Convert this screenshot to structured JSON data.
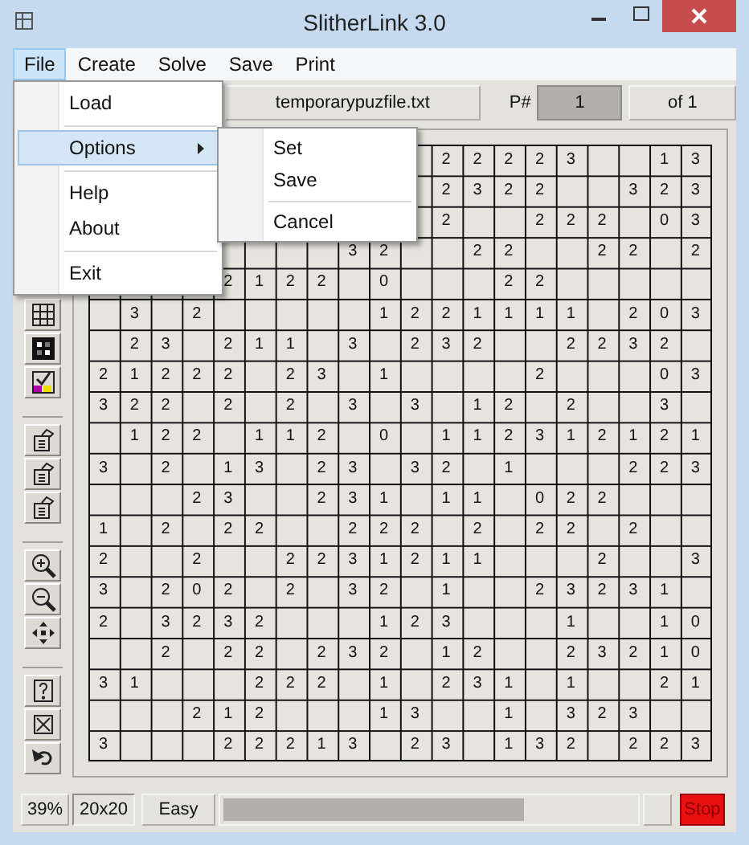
{
  "window": {
    "title": "SlitherLink 3.0"
  },
  "menu_bar": [
    {
      "label": "File",
      "selected": true
    },
    {
      "label": "Create",
      "selected": false
    },
    {
      "label": "Solve",
      "selected": false
    },
    {
      "label": "Save",
      "selected": false
    },
    {
      "label": "Print",
      "selected": false
    }
  ],
  "file_menu": [
    {
      "label": "Load",
      "selected": false,
      "separator_before": false,
      "has_submenu": false
    },
    {
      "label": "Options",
      "selected": true,
      "separator_before": true,
      "has_submenu": true
    },
    {
      "label": "Help",
      "selected": false,
      "separator_before": true,
      "has_submenu": false
    },
    {
      "label": "About",
      "selected": false,
      "separator_before": false,
      "has_submenu": false
    },
    {
      "label": "Exit",
      "selected": false,
      "separator_before": true,
      "has_submenu": false
    }
  ],
  "options_submenu": [
    {
      "label": "Set",
      "selected": false,
      "separator_before": false
    },
    {
      "label": "Save",
      "selected": false,
      "separator_before": false
    },
    {
      "label": "Cancel",
      "selected": false,
      "separator_before": true
    }
  ],
  "toolbar": {
    "file_name": "temporarypuzfile.txt",
    "puzzle_label": "P#",
    "puzzle_number": "1",
    "puzzle_count": "of 1"
  },
  "grid": {
    "rows": [
      [
        null,
        null,
        null,
        null,
        null,
        null,
        null,
        null,
        null,
        null,
        null,
        "2",
        "2",
        "2",
        "2",
        "3",
        null,
        null,
        "1",
        "3"
      ],
      [
        null,
        null,
        null,
        null,
        null,
        null,
        null,
        null,
        null,
        null,
        null,
        "2",
        "3",
        "2",
        "2",
        null,
        null,
        "3",
        "2",
        "3"
      ],
      [
        null,
        null,
        null,
        null,
        null,
        null,
        null,
        null,
        null,
        null,
        null,
        "2",
        null,
        null,
        "2",
        "2",
        "2",
        null,
        "0",
        "3"
      ],
      [
        null,
        null,
        null,
        null,
        null,
        null,
        null,
        null,
        "3",
        "2",
        null,
        null,
        "2",
        "2",
        null,
        null,
        "2",
        "2",
        null,
        "2"
      ],
      [
        null,
        null,
        null,
        null,
        "2",
        "1",
        "2",
        "2",
        null,
        "0",
        null,
        null,
        null,
        "2",
        "2",
        null,
        null,
        null,
        null,
        null
      ],
      [
        null,
        "3",
        null,
        "2",
        null,
        null,
        null,
        null,
        null,
        "1",
        "2",
        "2",
        "1",
        "1",
        "1",
        "1",
        null,
        "2",
        "0",
        "3"
      ],
      [
        null,
        "2",
        "3",
        null,
        "2",
        "1",
        "1",
        null,
        "3",
        null,
        "2",
        "3",
        "2",
        null,
        null,
        "2",
        "2",
        "3",
        "2",
        null
      ],
      [
        "2",
        "1",
        "2",
        "2",
        "2",
        null,
        "2",
        "3",
        null,
        "1",
        null,
        null,
        null,
        null,
        "2",
        null,
        null,
        null,
        "0",
        "3"
      ],
      [
        "3",
        "2",
        "2",
        null,
        "2",
        null,
        "2",
        null,
        "3",
        null,
        "3",
        null,
        "1",
        "2",
        null,
        "2",
        null,
        null,
        "3",
        null
      ],
      [
        null,
        "1",
        "2",
        "2",
        null,
        "1",
        "1",
        "2",
        null,
        "0",
        null,
        "1",
        "1",
        "2",
        "3",
        "1",
        "2",
        "1",
        "2",
        "1"
      ],
      [
        "3",
        null,
        "2",
        null,
        "1",
        "3",
        null,
        "2",
        "3",
        null,
        "3",
        "2",
        null,
        "1",
        null,
        null,
        null,
        "2",
        "2",
        "3"
      ],
      [
        null,
        null,
        null,
        "2",
        "3",
        null,
        null,
        "2",
        "3",
        "1",
        null,
        "1",
        "1",
        null,
        "0",
        "2",
        "2",
        null,
        null,
        null
      ],
      [
        "1",
        null,
        "2",
        null,
        "2",
        "2",
        null,
        null,
        "2",
        "2",
        "2",
        null,
        "2",
        null,
        "2",
        "2",
        null,
        "2",
        null,
        null
      ],
      [
        "2",
        null,
        null,
        "2",
        null,
        null,
        "2",
        "2",
        "3",
        "1",
        "2",
        "1",
        "1",
        null,
        null,
        null,
        "2",
        null,
        null,
        "3"
      ],
      [
        "3",
        null,
        "2",
        "0",
        "2",
        null,
        "2",
        null,
        "3",
        "2",
        null,
        "1",
        null,
        null,
        "2",
        "3",
        "2",
        "3",
        "1",
        null
      ],
      [
        "2",
        null,
        "3",
        "2",
        "3",
        "2",
        null,
        null,
        null,
        "1",
        "2",
        "3",
        null,
        null,
        null,
        "1",
        null,
        null,
        "1",
        "0"
      ],
      [
        null,
        null,
        "2",
        null,
        "2",
        "2",
        null,
        "2",
        "3",
        "2",
        null,
        "1",
        "2",
        null,
        null,
        "2",
        "3",
        "2",
        "1",
        "0"
      ],
      [
        "3",
        "1",
        null,
        null,
        null,
        "2",
        "2",
        "2",
        null,
        "1",
        null,
        "2",
        "3",
        "1",
        null,
        "1",
        null,
        null,
        "2",
        "1"
      ],
      [
        null,
        null,
        null,
        "2",
        "1",
        "2",
        null,
        null,
        null,
        "1",
        "3",
        null,
        null,
        "1",
        null,
        "3",
        "2",
        "3",
        null,
        null
      ],
      [
        "3",
        null,
        null,
        null,
        "2",
        "2",
        "2",
        "1",
        "3",
        null,
        "2",
        "3",
        null,
        "1",
        "3",
        "2",
        null,
        "2",
        "2",
        "3"
      ]
    ]
  },
  "status_bar": {
    "zoom": "39%",
    "size": "20x20",
    "difficulty": "Easy",
    "progress": {
      "level": 0.73
    },
    "stop": "Stop"
  }
}
